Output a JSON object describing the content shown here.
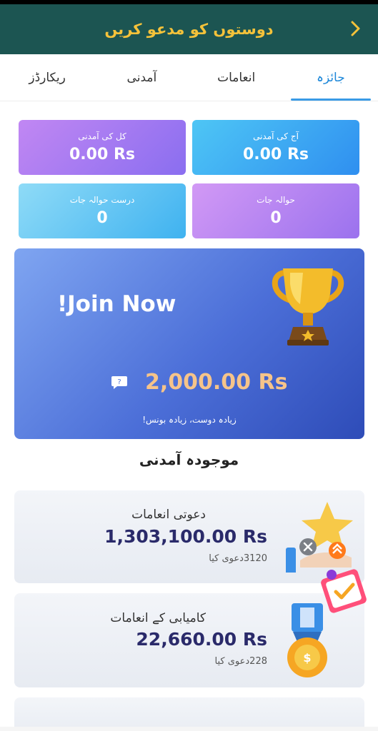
{
  "header": {
    "title": "دوستوں کو مدعو کریں"
  },
  "tabs": [
    {
      "label": "جائزہ",
      "active": true
    },
    {
      "label": "انعامات",
      "active": false
    },
    {
      "label": "آمدنی",
      "active": false
    },
    {
      "label": "ریکارڈز",
      "active": false
    }
  ],
  "stats": {
    "today_income": {
      "label": "آج کی آمدنی",
      "value": "0.00 Rs"
    },
    "total_income": {
      "label": "کل کی آمدنی",
      "value": "0.00 Rs"
    },
    "referrals": {
      "label": "حوالہ جات",
      "value": "0"
    },
    "valid_referrals": {
      "label": "درست حوالہ جات",
      "value": "0"
    }
  },
  "banner": {
    "join": "!Join Now",
    "amount": "2,000.00 Rs",
    "bonus_text": "زیادہ دوست، زیادہ بونس!"
  },
  "section_title": "موجودہ آمدنی",
  "cards": [
    {
      "title": "دعوتی انعامات",
      "amount": "1,303,100.00 Rs",
      "sub": "3120دعوی کیا"
    },
    {
      "title": "کامیابی کے انعامات",
      "amount": "22,660.00 Rs",
      "sub": "228دعوی کیا"
    }
  ],
  "colors": {
    "header_bg": "#1c5552",
    "header_text": "#f4c23a",
    "tab_active": "#1e88d9",
    "amount_text": "#2a2a6a",
    "banner_amount": "#f6c48a"
  }
}
